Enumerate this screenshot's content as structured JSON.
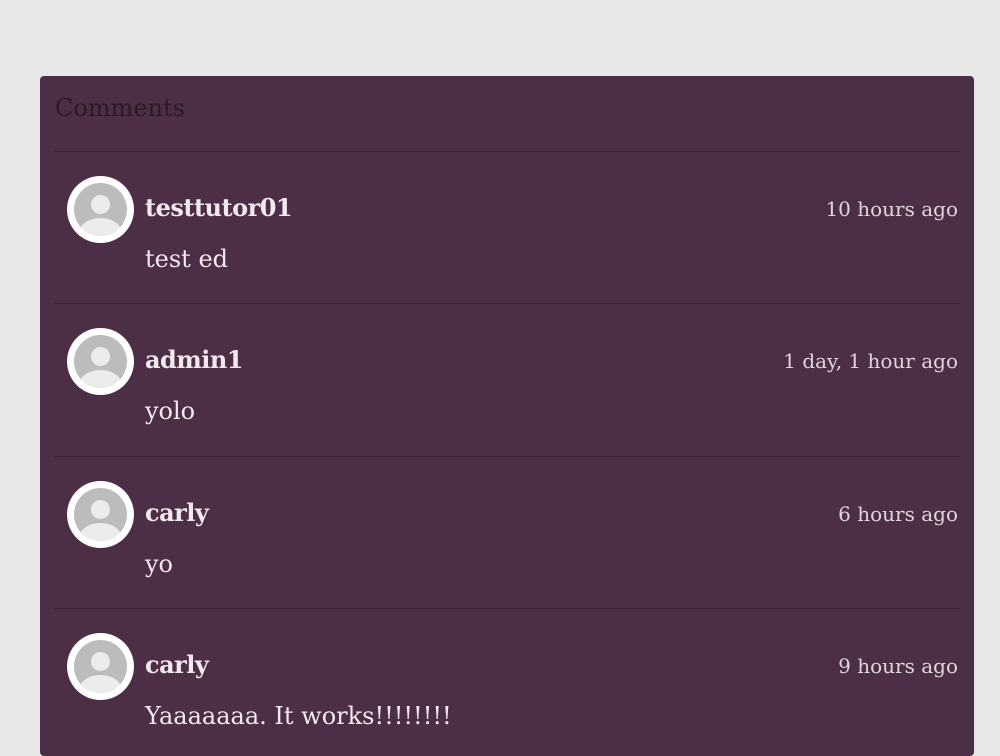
{
  "panel": {
    "title": "Comments"
  },
  "comments": [
    {
      "author": "testtutor01",
      "time": "10 hours ago",
      "text": "test ed",
      "avatar_icon": "default-user-icon"
    },
    {
      "author": "admin1",
      "time": "1 day, 1 hour ago",
      "text": "yolo",
      "avatar_icon": "default-user-icon"
    },
    {
      "author": "carly",
      "time": "6 hours ago",
      "text": "yo",
      "avatar_icon": "default-user-icon"
    },
    {
      "author": "carly",
      "time": "9 hours ago",
      "text": "Yaaaaaaa. It works!!!!!!!!",
      "avatar_icon": "default-user-icon"
    }
  ],
  "colors": {
    "page_background": "#e8e8e8",
    "panel_background": "#4d2e47",
    "text": "#f2e9ef"
  }
}
